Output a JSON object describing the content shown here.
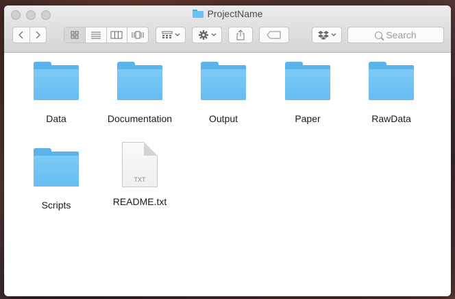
{
  "window": {
    "title": "ProjectName"
  },
  "toolbar": {
    "search_placeholder": "Search",
    "view_modes": [
      "icon-view",
      "list-view",
      "column-view",
      "cover-flow-view"
    ],
    "active_view": "icon-view"
  },
  "items": [
    {
      "name": "Data",
      "kind": "folder"
    },
    {
      "name": "Documentation",
      "kind": "folder"
    },
    {
      "name": "Output",
      "kind": "folder"
    },
    {
      "name": "Paper",
      "kind": "folder"
    },
    {
      "name": "RawData",
      "kind": "folder"
    },
    {
      "name": "Scripts",
      "kind": "folder"
    },
    {
      "name": "README.txt",
      "kind": "file",
      "ext": "TXT"
    }
  ],
  "colors": {
    "folder_front": "#6cc0f2",
    "folder_back": "#5cb3ec",
    "titlebar": "#e2e1e2"
  }
}
